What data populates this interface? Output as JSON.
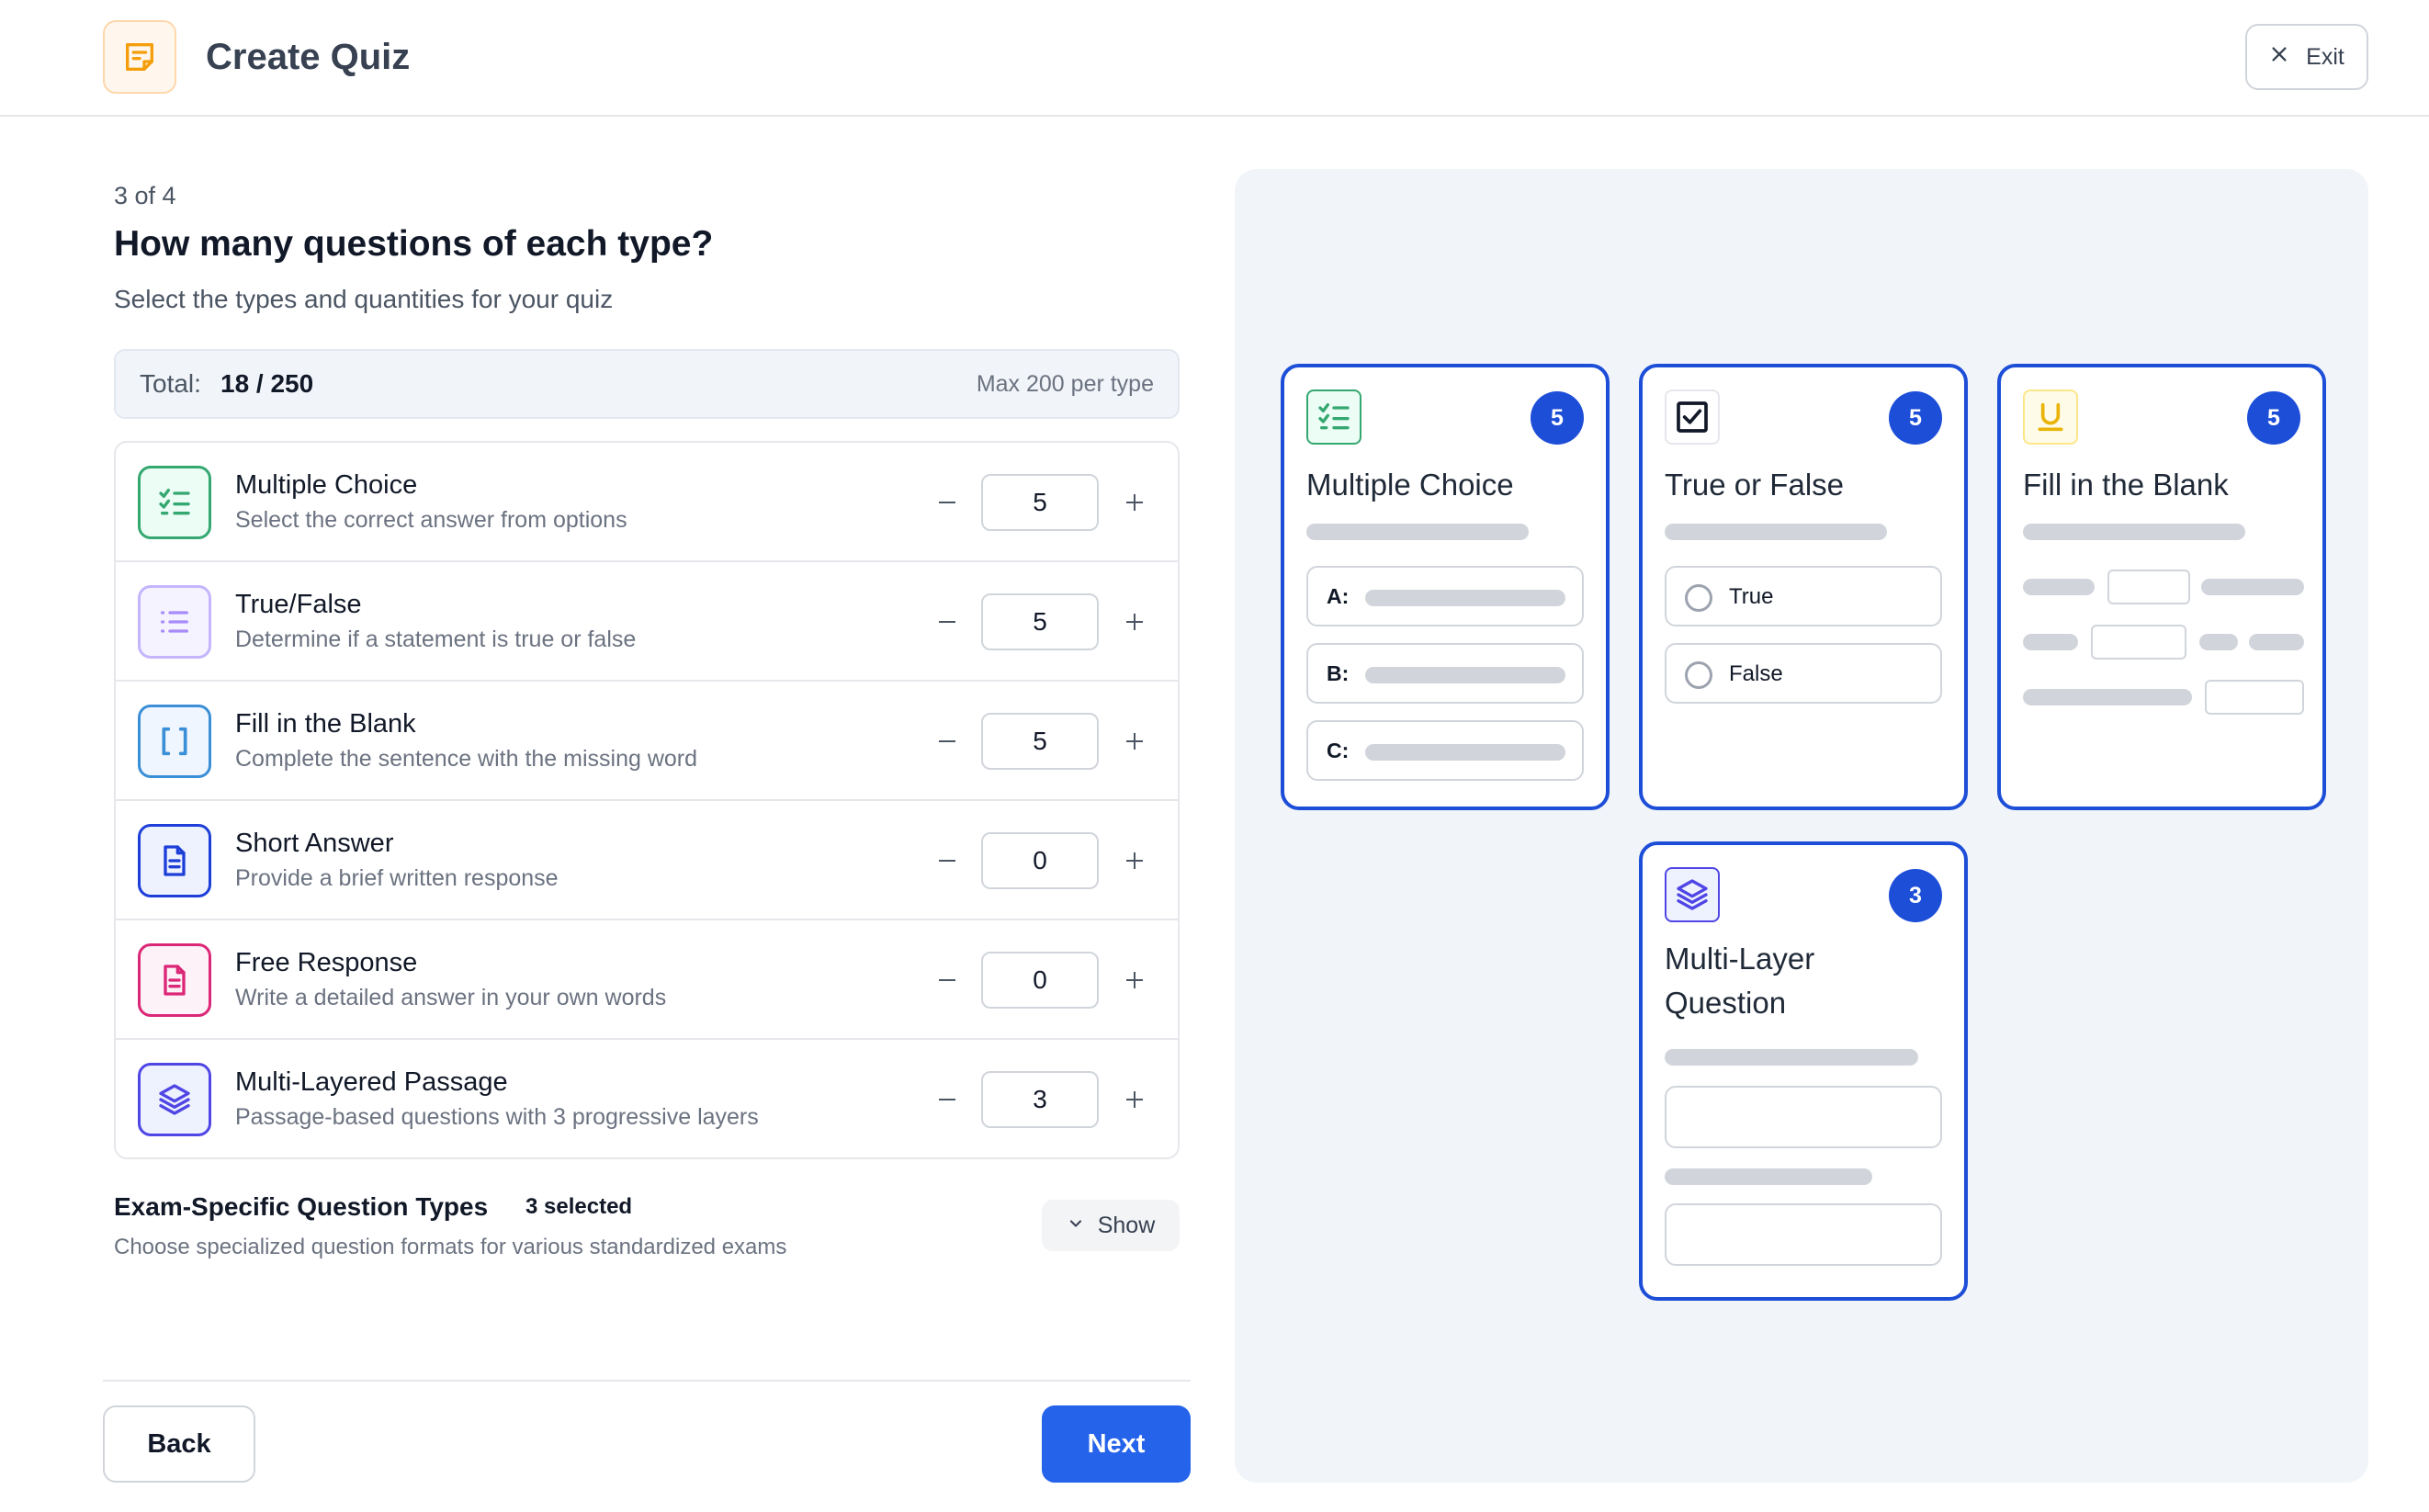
{
  "header": {
    "title": "Create Quiz",
    "exit_label": "Exit"
  },
  "step": {
    "indicator": "3 of 4",
    "heading": "How many questions of each type?",
    "subheading": "Select the types and quantities for your quiz"
  },
  "total": {
    "label": "Total:",
    "value": "18 / 250",
    "max_note": "Max 200 per type"
  },
  "question_types": [
    {
      "name": "Multiple Choice",
      "description": "Select the correct answer from options",
      "count": "5",
      "icon": "checklist-icon",
      "color": "#34a870"
    },
    {
      "name": "True/False",
      "description": "Determine if a statement is true or false",
      "count": "5",
      "icon": "list-icon",
      "color": "#a78bfa"
    },
    {
      "name": "Fill in the Blank",
      "description": "Complete the sentence with the missing word",
      "count": "5",
      "icon": "brackets-icon",
      "color": "#3b8fd6"
    },
    {
      "name": "Short Answer",
      "description": "Provide a brief written response",
      "count": "0",
      "icon": "document-icon",
      "color": "#1d3fd8"
    },
    {
      "name": "Free Response",
      "description": "Write a detailed answer in your own words",
      "count": "0",
      "icon": "document-icon",
      "color": "#db2777"
    },
    {
      "name": "Multi-Layered Passage",
      "description": "Passage-based questions with 3 progressive layers",
      "count": "3",
      "icon": "layers-icon",
      "color": "#4f46e5"
    }
  ],
  "exam": {
    "title": "Exam-Specific Question Types",
    "selected": "3 selected",
    "description": "Choose specialized question formats for various standardized exams",
    "show_label": "Show"
  },
  "footer": {
    "back_label": "Back",
    "next_label": "Next"
  },
  "preview": {
    "cards": [
      {
        "title": "Multiple Choice",
        "count": "5",
        "options": [
          "A:",
          "B:",
          "C:"
        ]
      },
      {
        "title": "True or False",
        "count": "5",
        "options": [
          "True",
          "False"
        ]
      },
      {
        "title": "Fill in the Blank",
        "count": "5"
      },
      {
        "title_line1": "Multi-Layer",
        "title_line2": "Question",
        "count": "3"
      }
    ]
  },
  "colors": {
    "accent": "#2563eb",
    "card_border": "#1d4ed8",
    "app_icon": "#f59e0b",
    "fill_blank_icon": "#eab308"
  }
}
